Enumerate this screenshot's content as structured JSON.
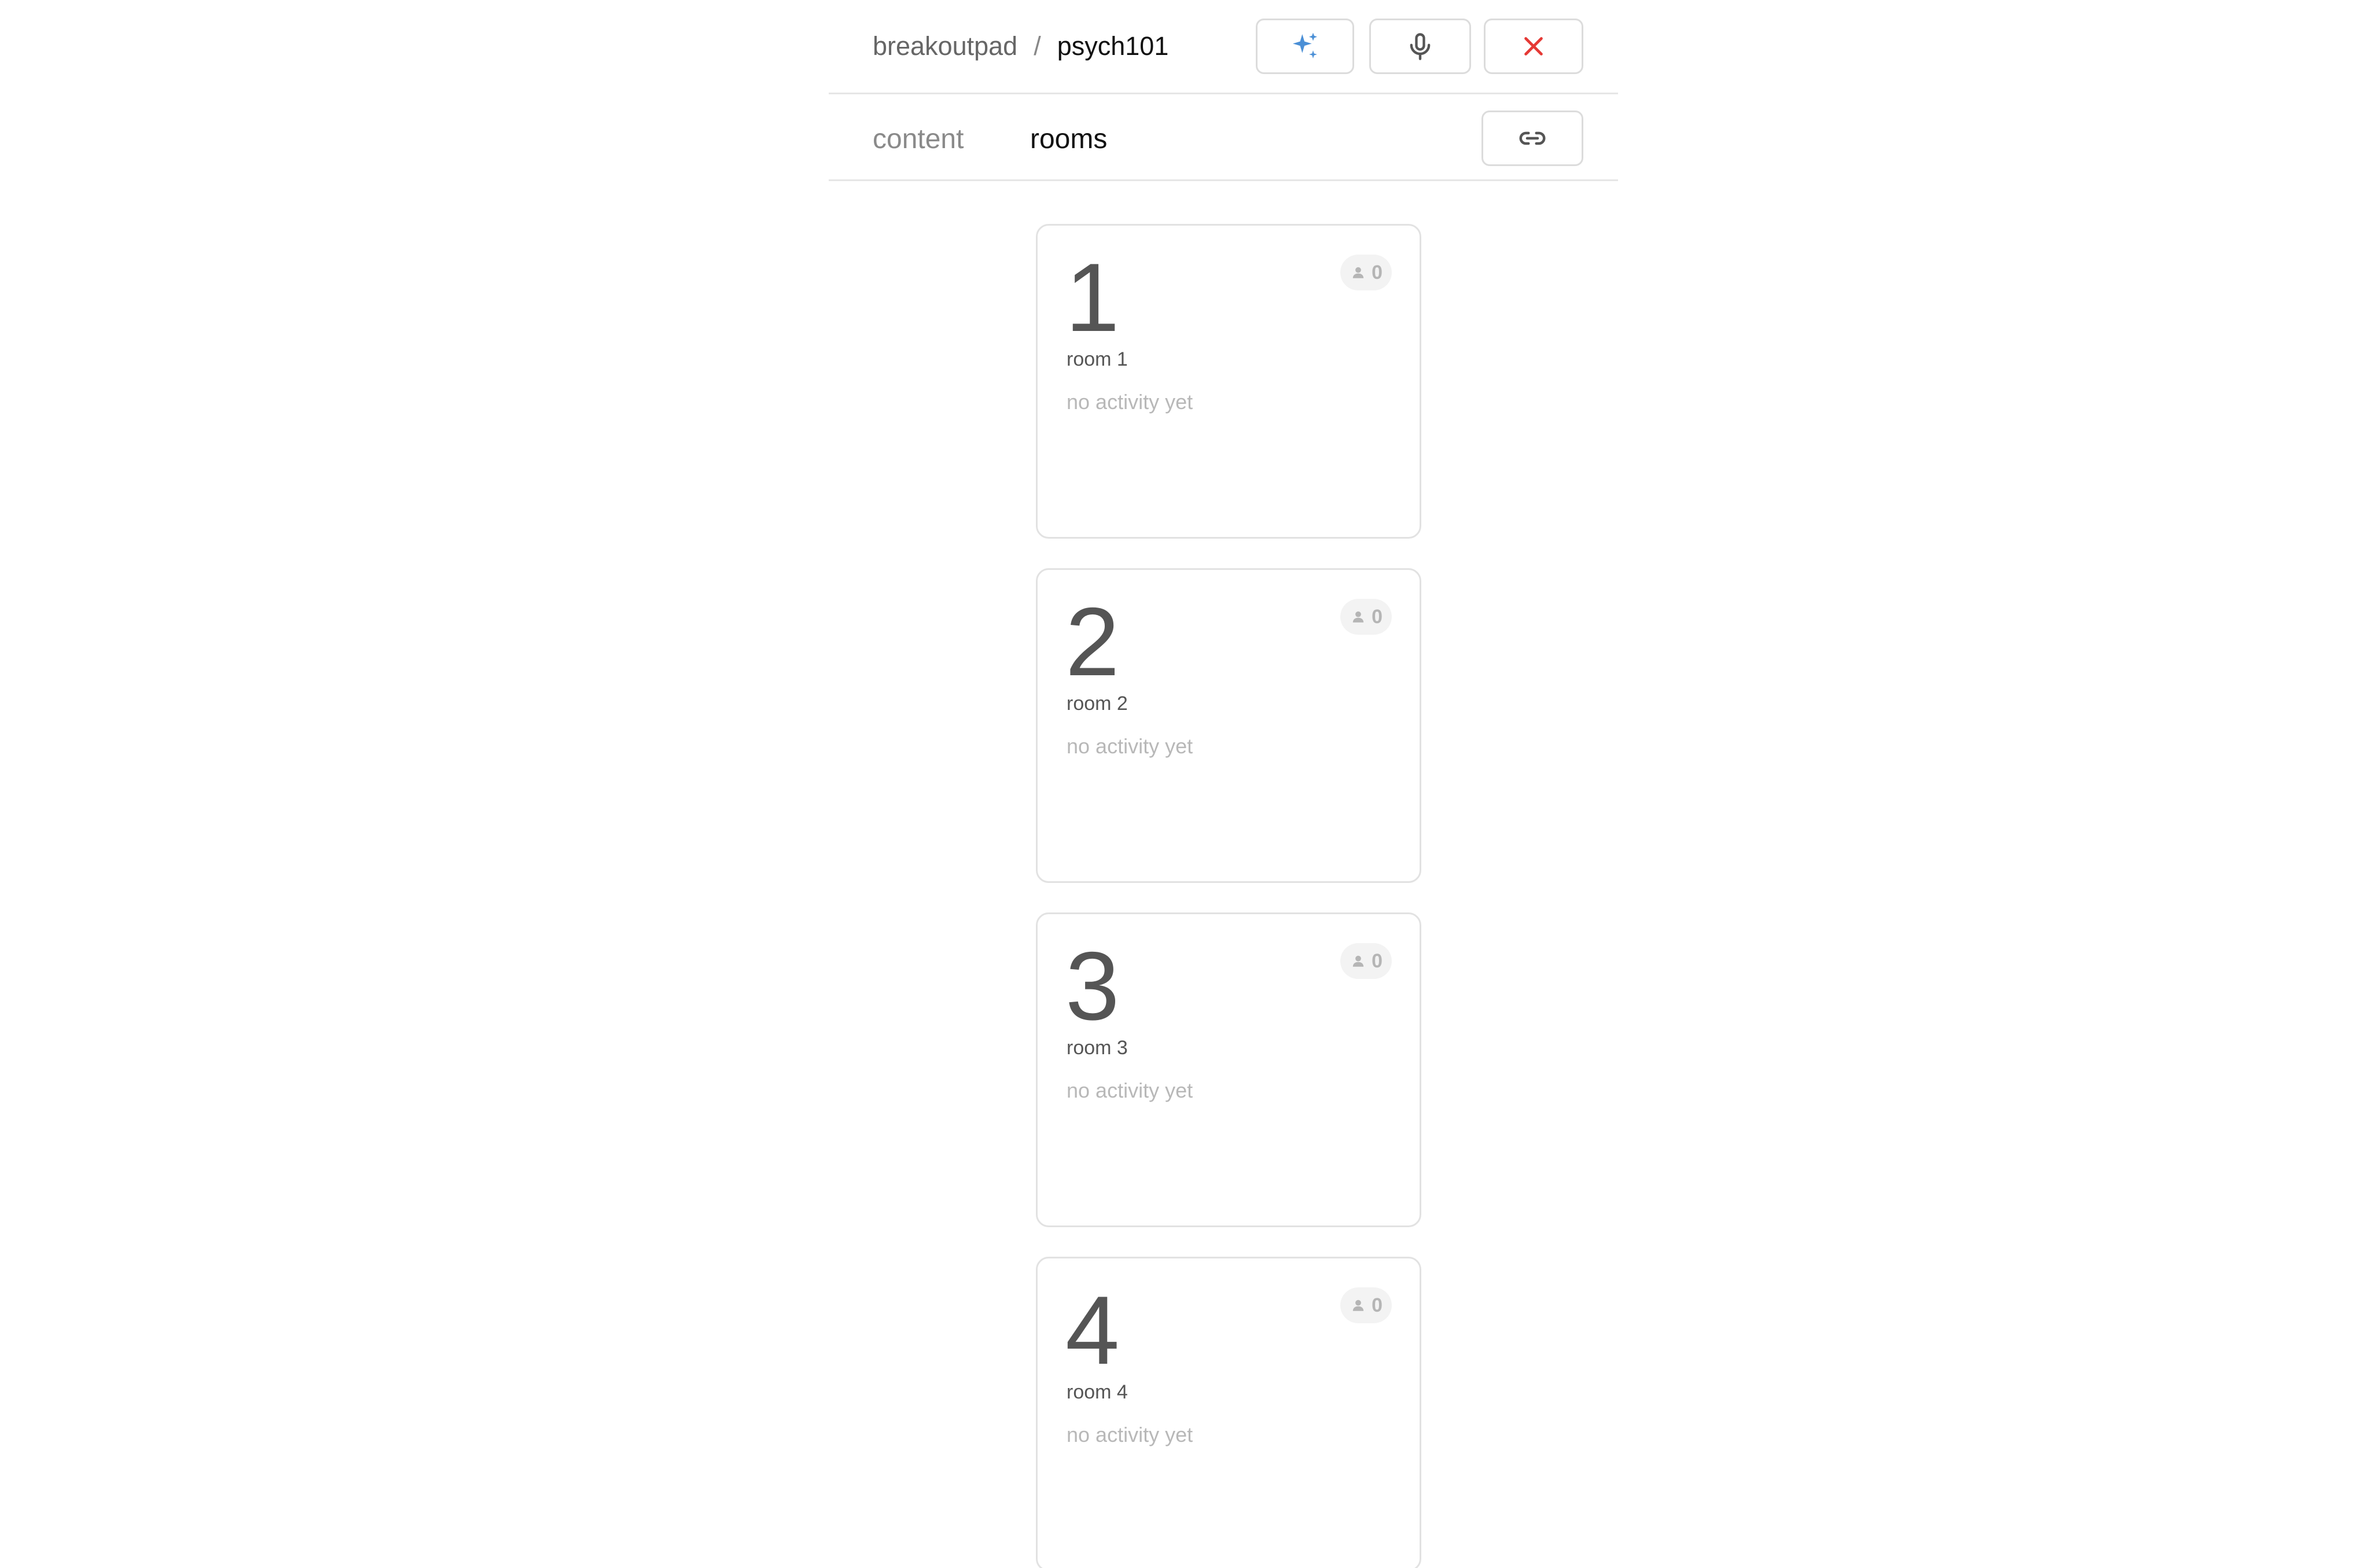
{
  "header": {
    "breadcrumb_root": "breakoutpad",
    "breadcrumb_separator": "/",
    "breadcrumb_current": "psych101",
    "actions": {
      "sparkle_icon": "sparkle-icon",
      "mic_icon": "microphone-icon",
      "close_icon": "close-icon"
    }
  },
  "tabs": {
    "content_label": "content",
    "rooms_label": "rooms",
    "active": "rooms",
    "link_icon": "link-icon"
  },
  "rooms": [
    {
      "number": "1",
      "name": "room 1",
      "activity": "no activity yet",
      "participants": "0"
    },
    {
      "number": "2",
      "name": "room 2",
      "activity": "no activity yet",
      "participants": "0"
    },
    {
      "number": "3",
      "name": "room 3",
      "activity": "no activity yet",
      "participants": "0"
    },
    {
      "number": "4",
      "name": "room 4",
      "activity": "no activity yet",
      "participants": "0"
    }
  ],
  "colors": {
    "highlight": "#ffe860",
    "sparkle": "#4a8fd6",
    "close": "#e53935",
    "card_border": "#e2e2e2"
  }
}
